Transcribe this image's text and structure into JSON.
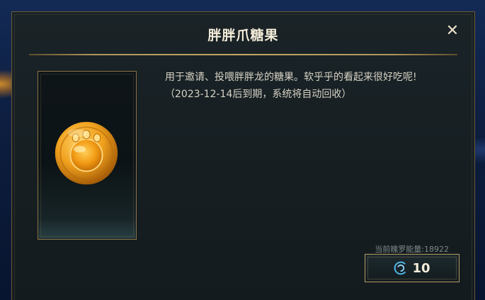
{
  "dialog": {
    "title": "胖胖爪糖果",
    "close_icon": "close-icon",
    "item": {
      "icon": "paw-candy-coin-icon"
    },
    "description": {
      "line1": "用于邀请、投喂胖胖龙的糖果。软乎乎的看起来很好吃呢!",
      "line2": "（2023-12-14后到期，系统将自动回收）"
    },
    "energy_label": "当前魄罗能量:18922",
    "cost": {
      "icon": "energy-swirl-icon",
      "value": "10"
    }
  },
  "colors": {
    "accent_gold": "#c4a767",
    "coin_orange": "#f0a21e",
    "energy_blue": "#4fb6e8"
  }
}
